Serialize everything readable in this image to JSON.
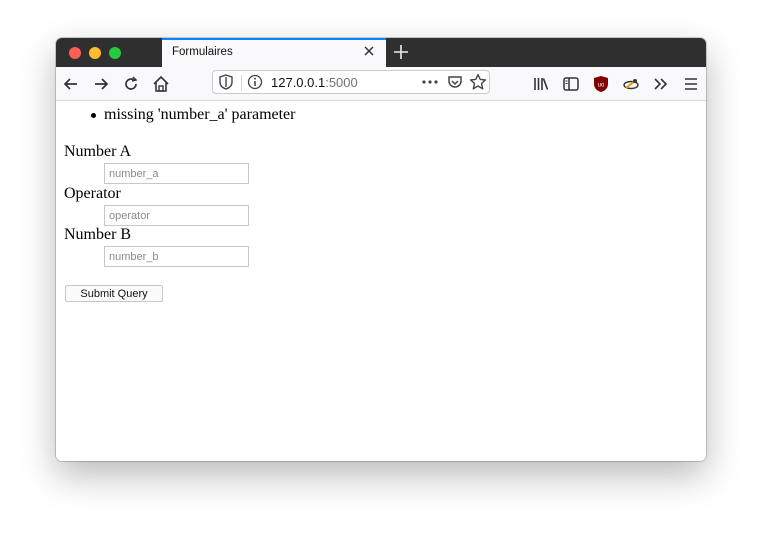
{
  "tab": {
    "title": "Formulaires"
  },
  "url": {
    "host": "127.0.0.1",
    "port": ":5000"
  },
  "errors": [
    "missing 'number_a' parameter"
  ],
  "form": {
    "number_a": {
      "label": "Number A",
      "placeholder": "number_a",
      "value": ""
    },
    "operator": {
      "label": "Operator",
      "placeholder": "operator",
      "value": ""
    },
    "number_b": {
      "label": "Number B",
      "placeholder": "number_b",
      "value": ""
    },
    "submit_label": "Submit Query"
  },
  "icons": {
    "back": "back-arrow-icon",
    "forward": "forward-arrow-icon",
    "reload": "reload-icon",
    "home": "home-icon",
    "shield": "tracking-shield-icon",
    "info": "site-info-icon",
    "more": "page-actions-icon",
    "pocket": "pocket-icon",
    "bookmark": "bookmark-star-icon",
    "library": "library-icon",
    "sidebar": "sidebar-icon",
    "ublock": "ublock-origin-icon",
    "extension": "extension-icon",
    "overflow": "overflow-chevron-icon",
    "menu": "hamburger-menu-icon"
  }
}
